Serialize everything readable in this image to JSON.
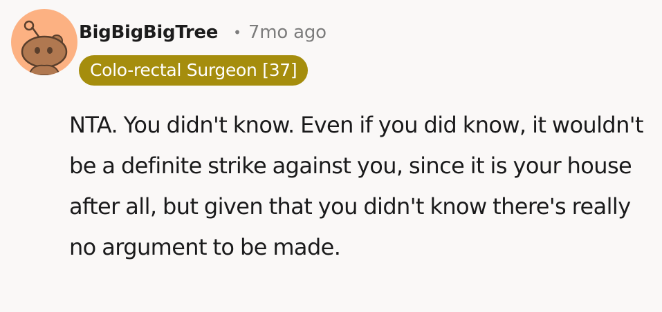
{
  "comment": {
    "avatar_icon": "snoo-avatar-icon",
    "username": "BigBigBigTree",
    "separator": "•",
    "timestamp": "7mo ago",
    "flair": "Colo-rectal Surgeon [37]",
    "flair_color": "#a58d0d",
    "body": "NTA. You didn't know. Even if you did know, it wouldn't be a definite strike against you, since it is your house after all, but given that you didn't know there's really no argument to be made."
  }
}
